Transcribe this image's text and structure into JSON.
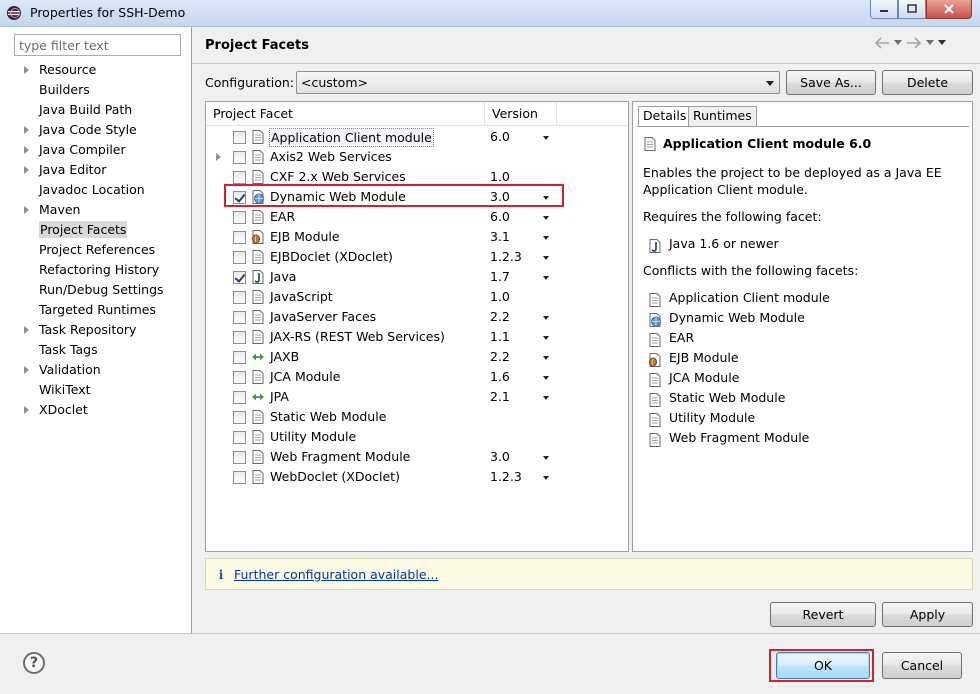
{
  "window": {
    "title": "Properties for SSH-Demo"
  },
  "filter": {
    "placeholder": "type filter text"
  },
  "nav": {
    "items": [
      {
        "label": "Resource",
        "expandable": true
      },
      {
        "label": "Builders",
        "expandable": false
      },
      {
        "label": "Java Build Path",
        "expandable": false
      },
      {
        "label": "Java Code Style",
        "expandable": true
      },
      {
        "label": "Java Compiler",
        "expandable": true
      },
      {
        "label": "Java Editor",
        "expandable": true
      },
      {
        "label": "Javadoc Location",
        "expandable": false
      },
      {
        "label": "Maven",
        "expandable": true
      },
      {
        "label": "Project Facets",
        "expandable": false,
        "selected": true
      },
      {
        "label": "Project References",
        "expandable": false
      },
      {
        "label": "Refactoring History",
        "expandable": false
      },
      {
        "label": "Run/Debug Settings",
        "expandable": false
      },
      {
        "label": "Targeted Runtimes",
        "expandable": false
      },
      {
        "label": "Task Repository",
        "expandable": true
      },
      {
        "label": "Task Tags",
        "expandable": false
      },
      {
        "label": "Validation",
        "expandable": true
      },
      {
        "label": "WikiText",
        "expandable": false
      },
      {
        "label": "XDoclet",
        "expandable": true
      }
    ]
  },
  "page": {
    "title": "Project Facets"
  },
  "config": {
    "label": "Configuration:",
    "value": "<custom>",
    "save_as": "Save As...",
    "delete": "Delete"
  },
  "table": {
    "col_facet": "Project Facet",
    "col_version": "Version",
    "rows": [
      {
        "name": "Application Client module",
        "version": "6.0",
        "checked": false,
        "dropdown": true,
        "icon": "page-icon",
        "selected": true
      },
      {
        "name": "Axis2 Web Services",
        "version": "",
        "checked": false,
        "dropdown": false,
        "icon": "page-icon",
        "expandable": true
      },
      {
        "name": "CXF 2.x Web Services",
        "version": "1.0",
        "checked": false,
        "dropdown": false,
        "icon": "page-icon"
      },
      {
        "name": "Dynamic Web Module",
        "version": "3.0",
        "checked": true,
        "dropdown": true,
        "icon": "globe-icon"
      },
      {
        "name": "EAR",
        "version": "6.0",
        "checked": false,
        "dropdown": true,
        "icon": "page-icon"
      },
      {
        "name": "EJB Module",
        "version": "3.1",
        "checked": false,
        "dropdown": true,
        "icon": "bean-icon"
      },
      {
        "name": "EJBDoclet (XDoclet)",
        "version": "1.2.3",
        "checked": false,
        "dropdown": true,
        "icon": "page-icon"
      },
      {
        "name": "Java",
        "version": "1.7",
        "checked": true,
        "dropdown": true,
        "icon": "java-icon"
      },
      {
        "name": "JavaScript",
        "version": "1.0",
        "checked": false,
        "dropdown": false,
        "icon": "page-icon"
      },
      {
        "name": "JavaServer Faces",
        "version": "2.2",
        "checked": false,
        "dropdown": true,
        "icon": "page-icon"
      },
      {
        "name": "JAX-RS (REST Web Services)",
        "version": "1.1",
        "checked": false,
        "dropdown": true,
        "icon": "page-icon"
      },
      {
        "name": "JAXB",
        "version": "2.2",
        "checked": false,
        "dropdown": true,
        "icon": "arrows-icon"
      },
      {
        "name": "JCA Module",
        "version": "1.6",
        "checked": false,
        "dropdown": true,
        "icon": "page-icon"
      },
      {
        "name": "JPA",
        "version": "2.1",
        "checked": false,
        "dropdown": true,
        "icon": "arrows-icon"
      },
      {
        "name": "Static Web Module",
        "version": "",
        "checked": false,
        "dropdown": false,
        "icon": "page-icon"
      },
      {
        "name": "Utility Module",
        "version": "",
        "checked": false,
        "dropdown": false,
        "icon": "page-icon"
      },
      {
        "name": "Web Fragment Module",
        "version": "3.0",
        "checked": false,
        "dropdown": true,
        "icon": "page-icon"
      },
      {
        "name": "WebDoclet (XDoclet)",
        "version": "1.2.3",
        "checked": false,
        "dropdown": true,
        "icon": "page-icon"
      }
    ]
  },
  "details": {
    "tab_details": "Details",
    "tab_runtimes": "Runtimes",
    "title": "Application Client module 6.0",
    "desc_line1": "Enables the project to be deployed as a Java EE",
    "desc_line2": "Application Client module.",
    "requires_label": "Requires the following facet:",
    "requires": [
      {
        "name": "Java 1.6 or newer",
        "icon": "java-icon"
      }
    ],
    "conflicts_label": "Conflicts with the following facets:",
    "conflicts": [
      {
        "name": "Application Client module",
        "icon": "page-icon"
      },
      {
        "name": "Dynamic Web Module",
        "icon": "globe-icon"
      },
      {
        "name": "EAR",
        "icon": "page-icon"
      },
      {
        "name": "EJB Module",
        "icon": "bean-icon"
      },
      {
        "name": "JCA Module",
        "icon": "page-icon"
      },
      {
        "name": "Static Web Module",
        "icon": "page-icon"
      },
      {
        "name": "Utility Module",
        "icon": "page-icon"
      },
      {
        "name": "Web Fragment Module",
        "icon": "page-icon"
      }
    ]
  },
  "info": {
    "icon": "i",
    "link": "Further configuration available..."
  },
  "buttons": {
    "revert": "Revert",
    "apply": "Apply",
    "ok": "OK",
    "cancel": "Cancel",
    "help": "?"
  },
  "colors": {
    "highlight": "#d8202c",
    "link": "#0033aa"
  }
}
